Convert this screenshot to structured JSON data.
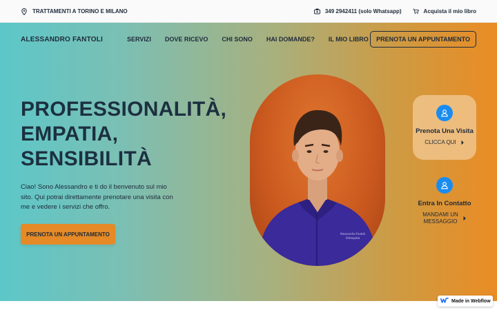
{
  "topbar": {
    "location": "TRATTAMENTI A TORINO E MILANO",
    "phone": "349 2942411 (solo Whatsapp)",
    "book": "Acquista il mio libro"
  },
  "nav": {
    "brand": "ALESSANDRO FANTOLI",
    "items": [
      "SERVIZI",
      "DOVE RICEVO",
      "CHI SONO",
      "HAI DOMANDE?",
      "IL MIO LIBRO"
    ],
    "cta": "PRENOTA UN APPUNTAMENTO"
  },
  "hero": {
    "headline": [
      "PROFESSIONALITÀ,",
      "EMPATIA,",
      "SENSIBILITÀ"
    ],
    "intro": "Ciao! Sono Alessandro e ti do il benvenuto sul mio sito. Qui potrai direttamente prenotare una visita con me e vedere i servizi che offro.",
    "cta": "PRENOTA UN APPUNTAMENTO",
    "shirt_text": "Alessandro Fantoli Osteopata"
  },
  "cards": {
    "visit": {
      "title": "Prenota Una Visita",
      "link": "CLICCA QUI"
    },
    "contact": {
      "title": "Entra In Contatto",
      "link_line1": "MANDAMI UN",
      "link_line2": "MESSAGGIO"
    }
  },
  "badge": {
    "label": "Made in Webflow"
  },
  "colors": {
    "accent": "#e58a26",
    "icon_blue": "#1a8cf0",
    "text": "#1e2a3a"
  }
}
